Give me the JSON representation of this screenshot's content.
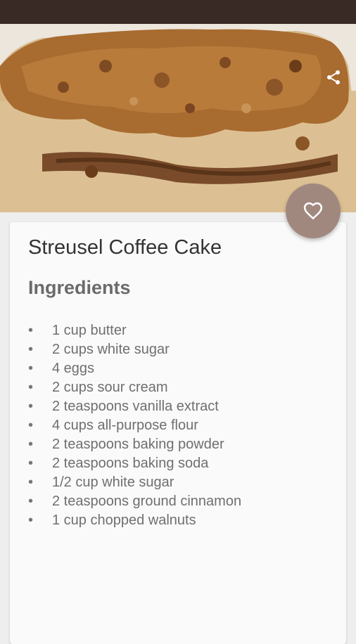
{
  "recipe": {
    "title": "Streusel Coffee Cake",
    "ingredients_heading": "Ingredients",
    "bullet": "•",
    "ingredients": [
      "1 cup butter",
      "2 cups white sugar",
      "4 eggs",
      "2 cups sour cream",
      "2 teaspoons vanilla extract",
      "4 cups all-purpose flour",
      "2 teaspoons baking powder",
      "2 teaspoons baking soda",
      "1/2 cup white sugar",
      "2 teaspoons ground cinnamon",
      "1 cup chopped walnuts"
    ]
  },
  "actions": {
    "share_icon": "share-icon",
    "favorite_icon": "heart-outline-icon"
  },
  "colors": {
    "status_bar": "#3a2a26",
    "fab": "#a1887f",
    "card": "#fafafa",
    "background": "#eeeeee"
  }
}
